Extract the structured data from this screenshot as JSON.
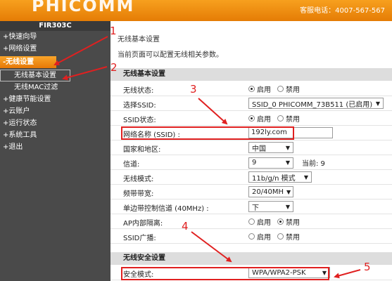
{
  "header": {
    "logo": "PHICOMM",
    "hotline": "客服电话：4007-567-567"
  },
  "sidebar": {
    "model": "FIR303C",
    "items": [
      {
        "label": "+快速向导"
      },
      {
        "label": "+网络设置"
      },
      {
        "label": "-无线设置"
      },
      {
        "label": "无线基本设置"
      },
      {
        "label": "无线MAC过滤"
      },
      {
        "label": "+健康节能设置"
      },
      {
        "label": "+云账户"
      },
      {
        "label": "+运行状态"
      },
      {
        "label": "+系统工具"
      },
      {
        "label": "+退出"
      }
    ]
  },
  "main": {
    "title": "无线基本设置",
    "desc": "当前页面可以配置无线相关参数。",
    "basic_section": "无线基本设置",
    "security_section": "无线安全设置",
    "rows": {
      "wireless_status": {
        "label": "无线状态:",
        "opt1": "启用",
        "opt2": "禁用"
      },
      "select_ssid": {
        "label": "选择SSID:",
        "value": "SSID_0 PHICOMM_73B511 (已启用)"
      },
      "ssid_status": {
        "label": "SSID状态:",
        "opt1": "启用",
        "opt2": "禁用"
      },
      "network_name": {
        "label": "网络名称 (SSID) :",
        "value": "192ly.com"
      },
      "country": {
        "label": "国家和地区:",
        "value": "中国"
      },
      "channel": {
        "label": "信道:",
        "value": "9",
        "current": "当前: 9"
      },
      "mode": {
        "label": "无线模式:",
        "value": "11b/g/n 模式"
      },
      "bandwidth": {
        "label": "频带带宽:",
        "value": "20/40MH"
      },
      "control_channel": {
        "label": "单边带控制信道 (40MHz) :",
        "value": "下"
      },
      "ap_isolation": {
        "label": "AP内部隔离:",
        "opt1": "启用",
        "opt2": "禁用"
      },
      "ssid_broadcast": {
        "label": "SSID广播:",
        "opt1": "启用",
        "opt2": "禁用"
      },
      "security_mode": {
        "label": "安全模式:",
        "value": "WPA/WPA2-PSK"
      }
    }
  },
  "annotations": [
    "1",
    "2",
    "3",
    "4",
    "5"
  ],
  "colors": {
    "accent": "#f29214",
    "annotation": "#e02020",
    "sidebar": "#4a4a4a"
  }
}
